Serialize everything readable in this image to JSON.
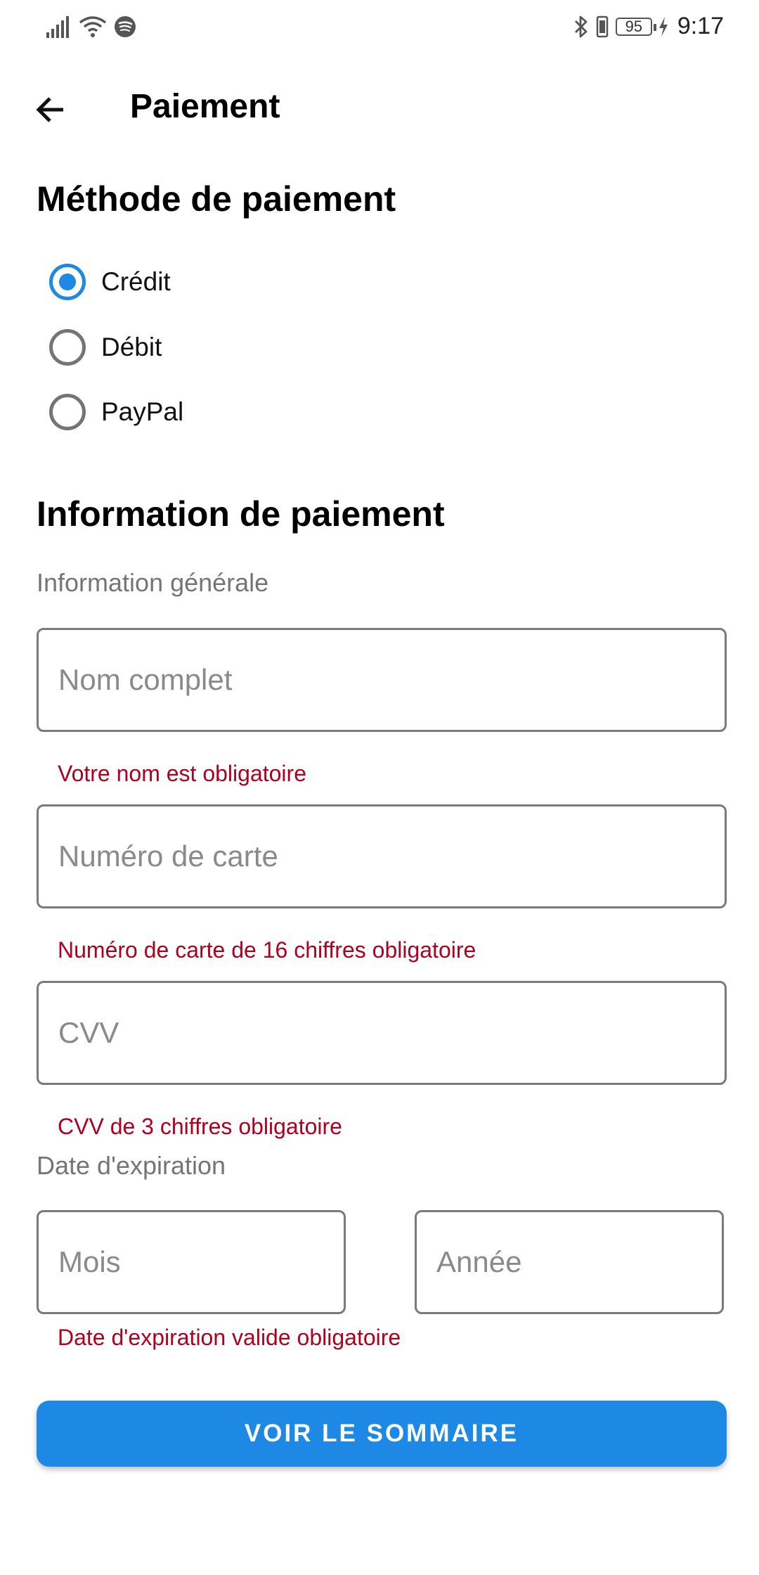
{
  "status_bar": {
    "battery": "95",
    "time": "9:17",
    "icons": [
      "signal-icon",
      "wifi-icon",
      "spotify-icon",
      "bluetooth-icon",
      "vibrate-icon",
      "battery-icon",
      "charging-icon"
    ]
  },
  "app_bar": {
    "title": "Paiement",
    "back_icon": "arrow-left-icon"
  },
  "payment_method": {
    "title": "Méthode de paiement",
    "options": [
      {
        "label": "Crédit",
        "selected": true
      },
      {
        "label": "Débit",
        "selected": false
      },
      {
        "label": "PayPal",
        "selected": false
      }
    ]
  },
  "payment_info": {
    "title": "Information de paiement",
    "general_label": "Information générale",
    "name": {
      "placeholder": "Nom complet",
      "value": "",
      "error": "Votre nom est obligatoire"
    },
    "card": {
      "placeholder": "Numéro de carte",
      "value": "",
      "error": "Numéro de carte de 16 chiffres obligatoire"
    },
    "cvv": {
      "placeholder": "CVV",
      "value": "",
      "error": "CVV de 3 chiffres obligatoire"
    },
    "expiry_label": "Date d'expiration",
    "month": {
      "placeholder": "Mois",
      "value": ""
    },
    "year": {
      "placeholder": "Année",
      "value": ""
    },
    "expiry_error": "Date d'expiration valide obligatoire"
  },
  "summary_button": "VOIR LE SOMMAIRE",
  "colors": {
    "accent": "#1e88e5",
    "error": "#b00020",
    "border": "#7a7a7a",
    "hint": "#757575"
  }
}
